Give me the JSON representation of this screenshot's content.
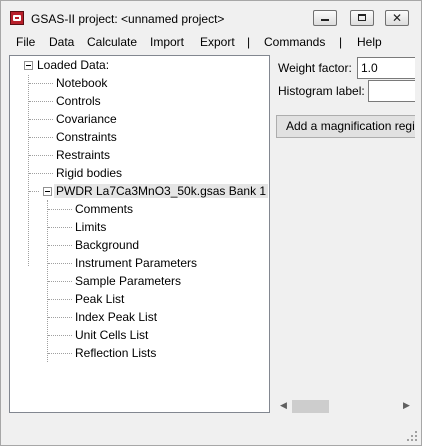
{
  "window": {
    "title": "GSAS-II project: <unnamed project>",
    "close_glyph": "✕"
  },
  "menubar": {
    "items": [
      {
        "label": "File"
      },
      {
        "label": "Data"
      },
      {
        "label": "Calculate"
      },
      {
        "label": "Import"
      },
      {
        "label": "Export"
      },
      {
        "label": "|"
      },
      {
        "label": "Commands"
      },
      {
        "label": "|"
      },
      {
        "label": "Help"
      }
    ]
  },
  "tree": {
    "root": {
      "label": "Loaded Data:"
    },
    "children": [
      {
        "label": "Notebook"
      },
      {
        "label": "Controls"
      },
      {
        "label": "Covariance"
      },
      {
        "label": "Constraints"
      },
      {
        "label": "Restraints"
      },
      {
        "label": "Rigid bodies"
      }
    ],
    "histogram": {
      "label": "PWDR La7Ca3MnO3_50k.gsas Bank 1",
      "children": [
        {
          "label": "Comments"
        },
        {
          "label": "Limits"
        },
        {
          "label": "Background"
        },
        {
          "label": "Instrument Parameters"
        },
        {
          "label": "Sample Parameters"
        },
        {
          "label": "Peak List"
        },
        {
          "label": "Index Peak List"
        },
        {
          "label": "Unit Cells List"
        },
        {
          "label": "Reflection Lists"
        }
      ]
    }
  },
  "panel": {
    "weight_factor_label": "Weight factor:",
    "weight_factor_value": "1.0",
    "histogram_label_label": "Histogram label:",
    "histogram_label_value": "",
    "magnification_button": "Add a magnification region"
  },
  "scrollbar": {
    "left_arrow": "◀",
    "right_arrow": "▶"
  },
  "colors": {
    "window_bg": "#f0f0f0",
    "tree_bg": "#ffffff",
    "selected_row": "#e5e5e5",
    "icon_red": "#b81f2a"
  }
}
